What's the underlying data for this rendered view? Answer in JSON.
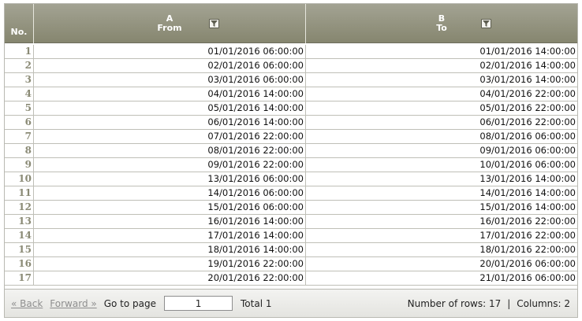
{
  "header": {
    "no_label": "No.",
    "col_a": {
      "letter": "A",
      "name": "From",
      "filter_icon": "filter-icon"
    },
    "col_b": {
      "letter": "B",
      "name": "To",
      "filter_icon": "filter-icon"
    }
  },
  "rows": [
    {
      "no": "1",
      "from": "01/01/2016 06:00:00",
      "to": "01/01/2016 14:00:00"
    },
    {
      "no": "2",
      "from": "02/01/2016 06:00:00",
      "to": "02/01/2016 14:00:00"
    },
    {
      "no": "3",
      "from": "03/01/2016 06:00:00",
      "to": "03/01/2016 14:00:00"
    },
    {
      "no": "4",
      "from": "04/01/2016 14:00:00",
      "to": "04/01/2016 22:00:00"
    },
    {
      "no": "5",
      "from": "05/01/2016 14:00:00",
      "to": "05/01/2016 22:00:00"
    },
    {
      "no": "6",
      "from": "06/01/2016 14:00:00",
      "to": "06/01/2016 22:00:00"
    },
    {
      "no": "7",
      "from": "07/01/2016 22:00:00",
      "to": "08/01/2016 06:00:00"
    },
    {
      "no": "8",
      "from": "08/01/2016 22:00:00",
      "to": "09/01/2016 06:00:00"
    },
    {
      "no": "9",
      "from": "09/01/2016 22:00:00",
      "to": "10/01/2016 06:00:00"
    },
    {
      "no": "10",
      "from": "13/01/2016 06:00:00",
      "to": "13/01/2016 14:00:00"
    },
    {
      "no": "11",
      "from": "14/01/2016 06:00:00",
      "to": "14/01/2016 14:00:00"
    },
    {
      "no": "12",
      "from": "15/01/2016 06:00:00",
      "to": "15/01/2016 14:00:00"
    },
    {
      "no": "13",
      "from": "16/01/2016 14:00:00",
      "to": "16/01/2016 22:00:00"
    },
    {
      "no": "14",
      "from": "17/01/2016 14:00:00",
      "to": "17/01/2016 22:00:00"
    },
    {
      "no": "15",
      "from": "18/01/2016 14:00:00",
      "to": "18/01/2016 22:00:00"
    },
    {
      "no": "16",
      "from": "19/01/2016 22:00:00",
      "to": "20/01/2016 06:00:00"
    },
    {
      "no": "17",
      "from": "20/01/2016 22:00:00",
      "to": "21/01/2016 06:00:00"
    }
  ],
  "footer": {
    "back_label": "« Back",
    "forward_label": "Forward »",
    "goto_label": "Go to page",
    "page_value": "1",
    "total_label": "Total 1",
    "rows_label": "Number of rows: 17",
    "separator": "|",
    "columns_label": "Columns: 2"
  }
}
